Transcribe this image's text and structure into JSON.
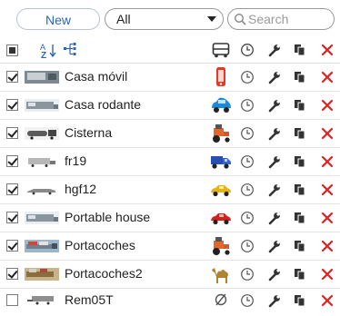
{
  "toolbar": {
    "new_label": "New",
    "filter_value": "All",
    "search_placeholder": "Search"
  },
  "colors": {
    "accent": "#2a66b3",
    "delete": "#e02020",
    "text": "#222222"
  },
  "header_icons": [
    "select-all-checkbox",
    "sort-az-icon",
    "group-tree-icon",
    "bus-icon",
    "clock-icon",
    "wrench-icon",
    "copy-icon",
    "delete-icon"
  ],
  "rows": [
    {
      "name": "Casa móvil",
      "checked": true,
      "vehicle_icon": "phone-icon"
    },
    {
      "name": "Casa rodante",
      "checked": true,
      "vehicle_icon": "blue-car-icon"
    },
    {
      "name": "Cisterna",
      "checked": true,
      "vehicle_icon": "tractor-icon"
    },
    {
      "name": "fr19",
      "checked": true,
      "vehicle_icon": "blue-truck-icon"
    },
    {
      "name": "hgf12",
      "checked": true,
      "vehicle_icon": "yellow-car-icon"
    },
    {
      "name": "Portable house",
      "checked": true,
      "vehicle_icon": "red-car-icon"
    },
    {
      "name": "Portacoches",
      "checked": true,
      "vehicle_icon": "tractor-icon"
    },
    {
      "name": "Portacoches2",
      "checked": true,
      "vehicle_icon": "camel-icon"
    },
    {
      "name": "Rem05T",
      "checked": false,
      "vehicle_icon": "no-icon"
    }
  ]
}
